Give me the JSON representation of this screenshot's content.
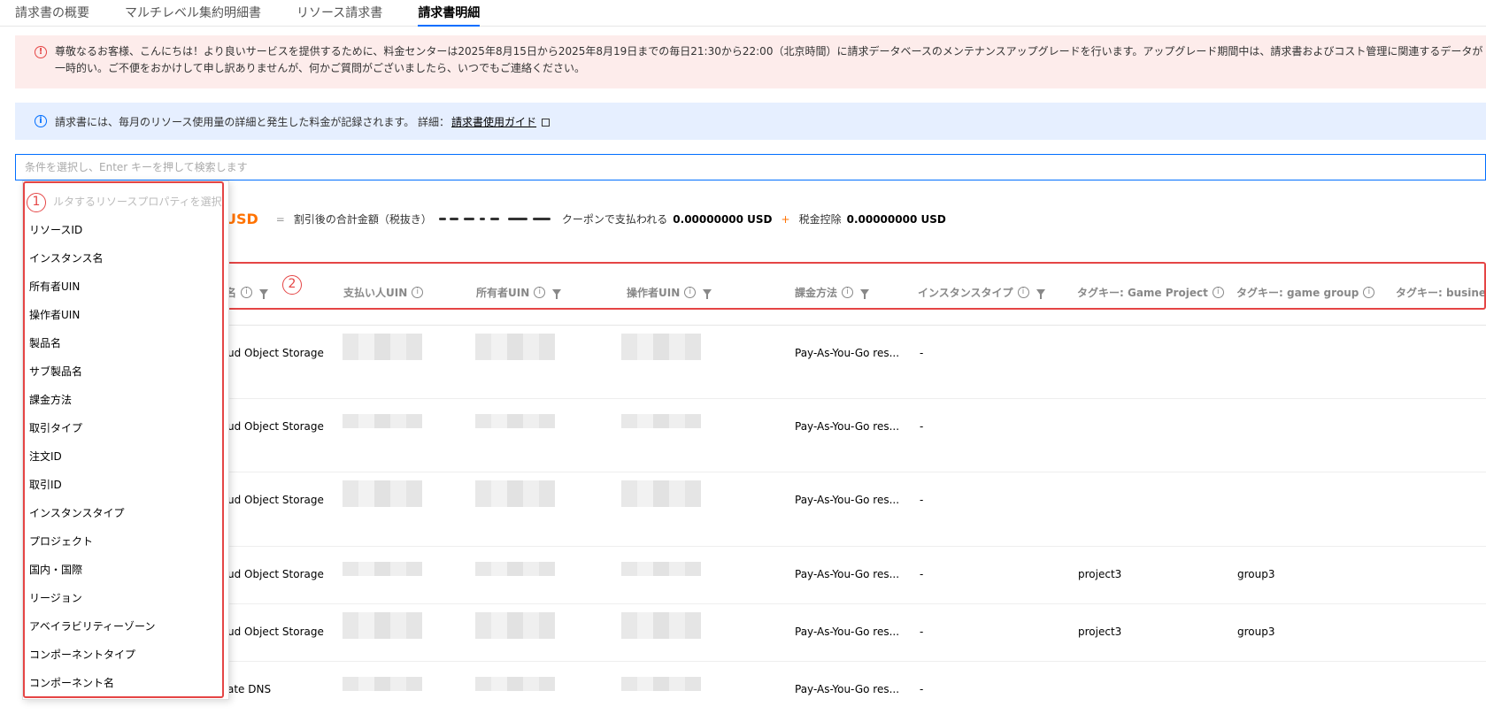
{
  "tabs": [
    "請求書の概要",
    "マルチレベル集約明細書",
    "リソース請求書",
    "請求書明細"
  ],
  "alert_error": {
    "icon": "!",
    "text": "尊敬なるお客様、こんにちは！より良いサービスを提供するために、料金センターは2025年8月15日から2025年8月19日までの毎日21:30から22:00（北京時間）に請求データベースのメンテナンスアップグレードを行います。アップグレード期間中は、請求書およびコスト管理に関連するデータが一時的い。ご不便をおかけして申し訳ありませんが、何かご質問がございましたら、いつでもご連絡ください。"
  },
  "alert_info": {
    "icon": "i",
    "text": "請求書には、毎月のリソース使用量の詳細と発生した料金が記録されます。 詳細：",
    "link": "請求書使用ガイド"
  },
  "search": {
    "placeholder": "条件を選択し、Enter キーを押して検索します"
  },
  "summary": {
    "usd": "USD",
    "eq": "=",
    "label1": "割引後の合計金額（税抜き）",
    "label2": "クーポンで支払われる",
    "value2": "0.00000000 USD",
    "plus": "+",
    "label3": "税金控除",
    "value3": "0.00000000 USD"
  },
  "table": {
    "headers": [
      "名",
      "支払い人UIN",
      "所有者UIN",
      "操作者UIN",
      "課金方法",
      "インスタンスタイプ",
      "タグキー: Game Project",
      "タグキー: game group",
      "タグキー: busines"
    ],
    "rows": [
      {
        "product": "ud Object Storage",
        "billing": "Pay-As-You-Go res...",
        "instance": "-",
        "tag1": "",
        "tag2": ""
      },
      {
        "product": "ud Object Storage",
        "billing": "Pay-As-You-Go res...",
        "instance": "-",
        "tag1": "",
        "tag2": ""
      },
      {
        "product": "ud Object Storage",
        "billing": "Pay-As-You-Go res...",
        "instance": "-",
        "tag1": "",
        "tag2": ""
      },
      {
        "product": "ud Object Storage",
        "billing": "Pay-As-You-Go res...",
        "instance": "-",
        "tag1": "project3",
        "tag2": "group3"
      },
      {
        "product": "ud Object Storage",
        "billing": "Pay-As-You-Go res...",
        "instance": "-",
        "tag1": "project3",
        "tag2": "group3"
      },
      {
        "product": "ate DNS",
        "billing": "Pay-As-You-Go res...",
        "instance": "-",
        "tag1": "",
        "tag2": ""
      }
    ]
  },
  "dropdown": {
    "placeholder": "ルタするリソースプロパティを選択",
    "items": [
      "リソースID",
      "インスタンス名",
      "所有者UIN",
      "操作者UIN",
      "製品名",
      "サブ製品名",
      "課金方法",
      "取引タイプ",
      "注文ID",
      "取引ID",
      "インスタンスタイプ",
      "プロジェクト",
      "国内・国際",
      "リージョン",
      "アベイラビリティーゾーン",
      "コンポーネントタイプ",
      "コンポーネント名"
    ]
  },
  "annotations": {
    "badge1": "1",
    "badge2": "2"
  },
  "colors": {
    "accent": "#006eff",
    "highlight": "#e54545",
    "usd": "#ff7200"
  }
}
